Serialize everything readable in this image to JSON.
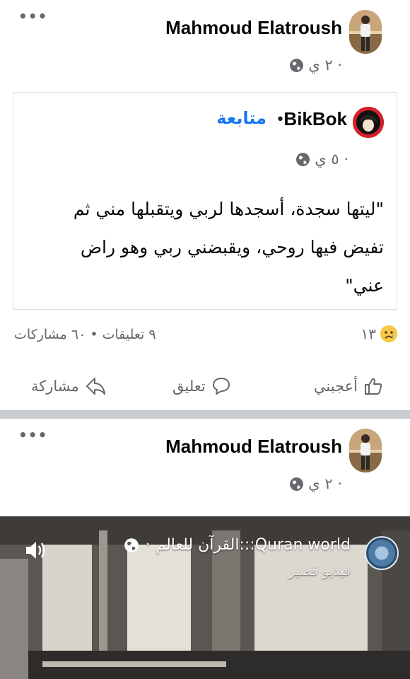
{
  "post1": {
    "author": "Mahmoud Elatroush",
    "time": "٢ ي ·",
    "more": "•••",
    "shared": {
      "author": "BikBok",
      "separator": "•",
      "follow": "متابعة",
      "time": "٥ ي ·",
      "text": "\"ليتها سجدة، أسجدها لربي ويتقبلها مني ثم تفيض فيها روحي، ويقبضني ربي وهو راض عني\""
    },
    "reactions_count": "١٣",
    "counts": "٩ تعليقات • ٦٠ مشاركات",
    "actions": {
      "like": "أعجبني",
      "comment": "تعليق",
      "share": "مشاركة"
    }
  },
  "post2": {
    "author": "Mahmoud Elatroush",
    "time": "٢ ي ·",
    "more": "•••",
    "video": {
      "channel": "القرآن للعالم:::Quran world",
      "subtitle": "فيديو قصير"
    }
  },
  "colors": {
    "link": "#1877f2",
    "secondary_text": "#65676b",
    "separator": "#c9ccd1"
  }
}
